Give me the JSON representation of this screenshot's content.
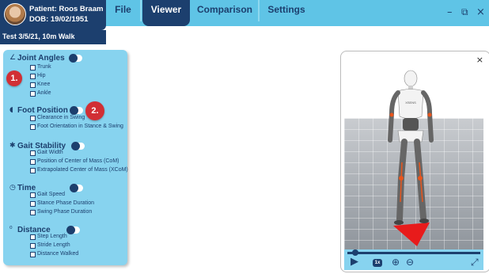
{
  "patient": {
    "name": "Patient: Roos Braam",
    "dob": "DOB: 19/02/1951",
    "avatar_icon": "patient-photo"
  },
  "session": {
    "label": "Test 3/5/21, 10m Walk"
  },
  "nav": {
    "tabs": [
      {
        "label": "File",
        "active": false
      },
      {
        "label": "Viewer",
        "active": true
      },
      {
        "label": "Comparison",
        "active": false
      },
      {
        "label": "Settings",
        "active": false
      }
    ]
  },
  "window_controls": {
    "minimize": "–",
    "restore": "⧉",
    "close": "×"
  },
  "panel": {
    "sections": [
      {
        "title": "Joint Angles",
        "icon": "angle-icon",
        "toggle_on": false,
        "options": [
          "Trunk",
          "Hip",
          "Knee",
          "Ankle"
        ]
      },
      {
        "title": "Foot Position",
        "icon": "foot-icon",
        "toggle_on": false,
        "options": [
          "Clearance in Swing",
          "Foot Orientation in Stance & Swing"
        ]
      },
      {
        "title": "Gait Stability",
        "icon": "walking-person-icon",
        "toggle_on": false,
        "options": [
          "Gait Width",
          "Position of Center of Mass (CoM)",
          "Extrapolated Center of Mass (XCoM)"
        ]
      },
      {
        "title": "Time",
        "icon": "clock-icon",
        "toggle_on": false,
        "options": [
          "Gait Speed",
          "Stance Phase Duration",
          "Swing Phase Duration"
        ]
      },
      {
        "title": "Distance",
        "icon": "footsteps-icon",
        "toggle_on": false,
        "options": [
          "Step Length",
          "Stride Length",
          "Distance Walked"
        ]
      }
    ]
  },
  "markers": [
    "1.",
    "2."
  ],
  "viewer": {
    "close_label": "×",
    "speed": "1x",
    "playback_progress": 0.06,
    "play_icon": "play-icon",
    "zoom_in_icon": "zoom-in-icon",
    "zoom_out_icon": "zoom-out-icon",
    "expand_icon": "expand-icon"
  },
  "colors": {
    "navy": "#1c3f6e",
    "topbar": "#5fc4e6",
    "panel": "#87d3ef",
    "marker": "#d12f35",
    "figure_accent": "#e8551c"
  }
}
